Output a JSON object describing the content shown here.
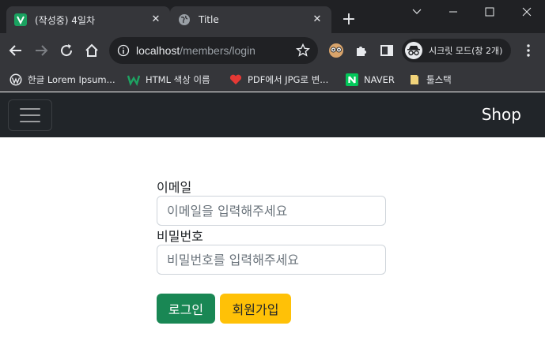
{
  "browser": {
    "tabs": [
      {
        "title": "(작성중) 4일차",
        "favicon": "v-logo-icon",
        "active": false
      },
      {
        "title": "Title",
        "favicon": "globe-icon",
        "active": true
      }
    ],
    "address": {
      "host": "localhost",
      "path": "/members/login"
    },
    "incognito_label": "시크릿 모드(창 2개)",
    "bookmarks": [
      {
        "label": "한글 Lorem Ipsum...",
        "icon": "wordpress-icon"
      },
      {
        "label": "HTML 색상 이름",
        "icon": "w-logo-icon"
      },
      {
        "label": "PDF에서 JPG로 변...",
        "icon": "heart-icon"
      },
      {
        "label": "NAVER",
        "icon": "naver-icon"
      },
      {
        "label": "툴스택",
        "icon": "folder-icon"
      }
    ]
  },
  "navbar": {
    "brand": "Shop"
  },
  "login": {
    "email_label": "이메일",
    "email_placeholder": "이메일을 입력해주세요",
    "password_label": "비밀번호",
    "password_placeholder": "비밀번호를 입력해주세요",
    "login_button": "로그인",
    "signup_button": "회원가입"
  },
  "colors": {
    "navbar_bg": "#212529",
    "login_button": "#198754",
    "signup_button": "#ffc107"
  }
}
